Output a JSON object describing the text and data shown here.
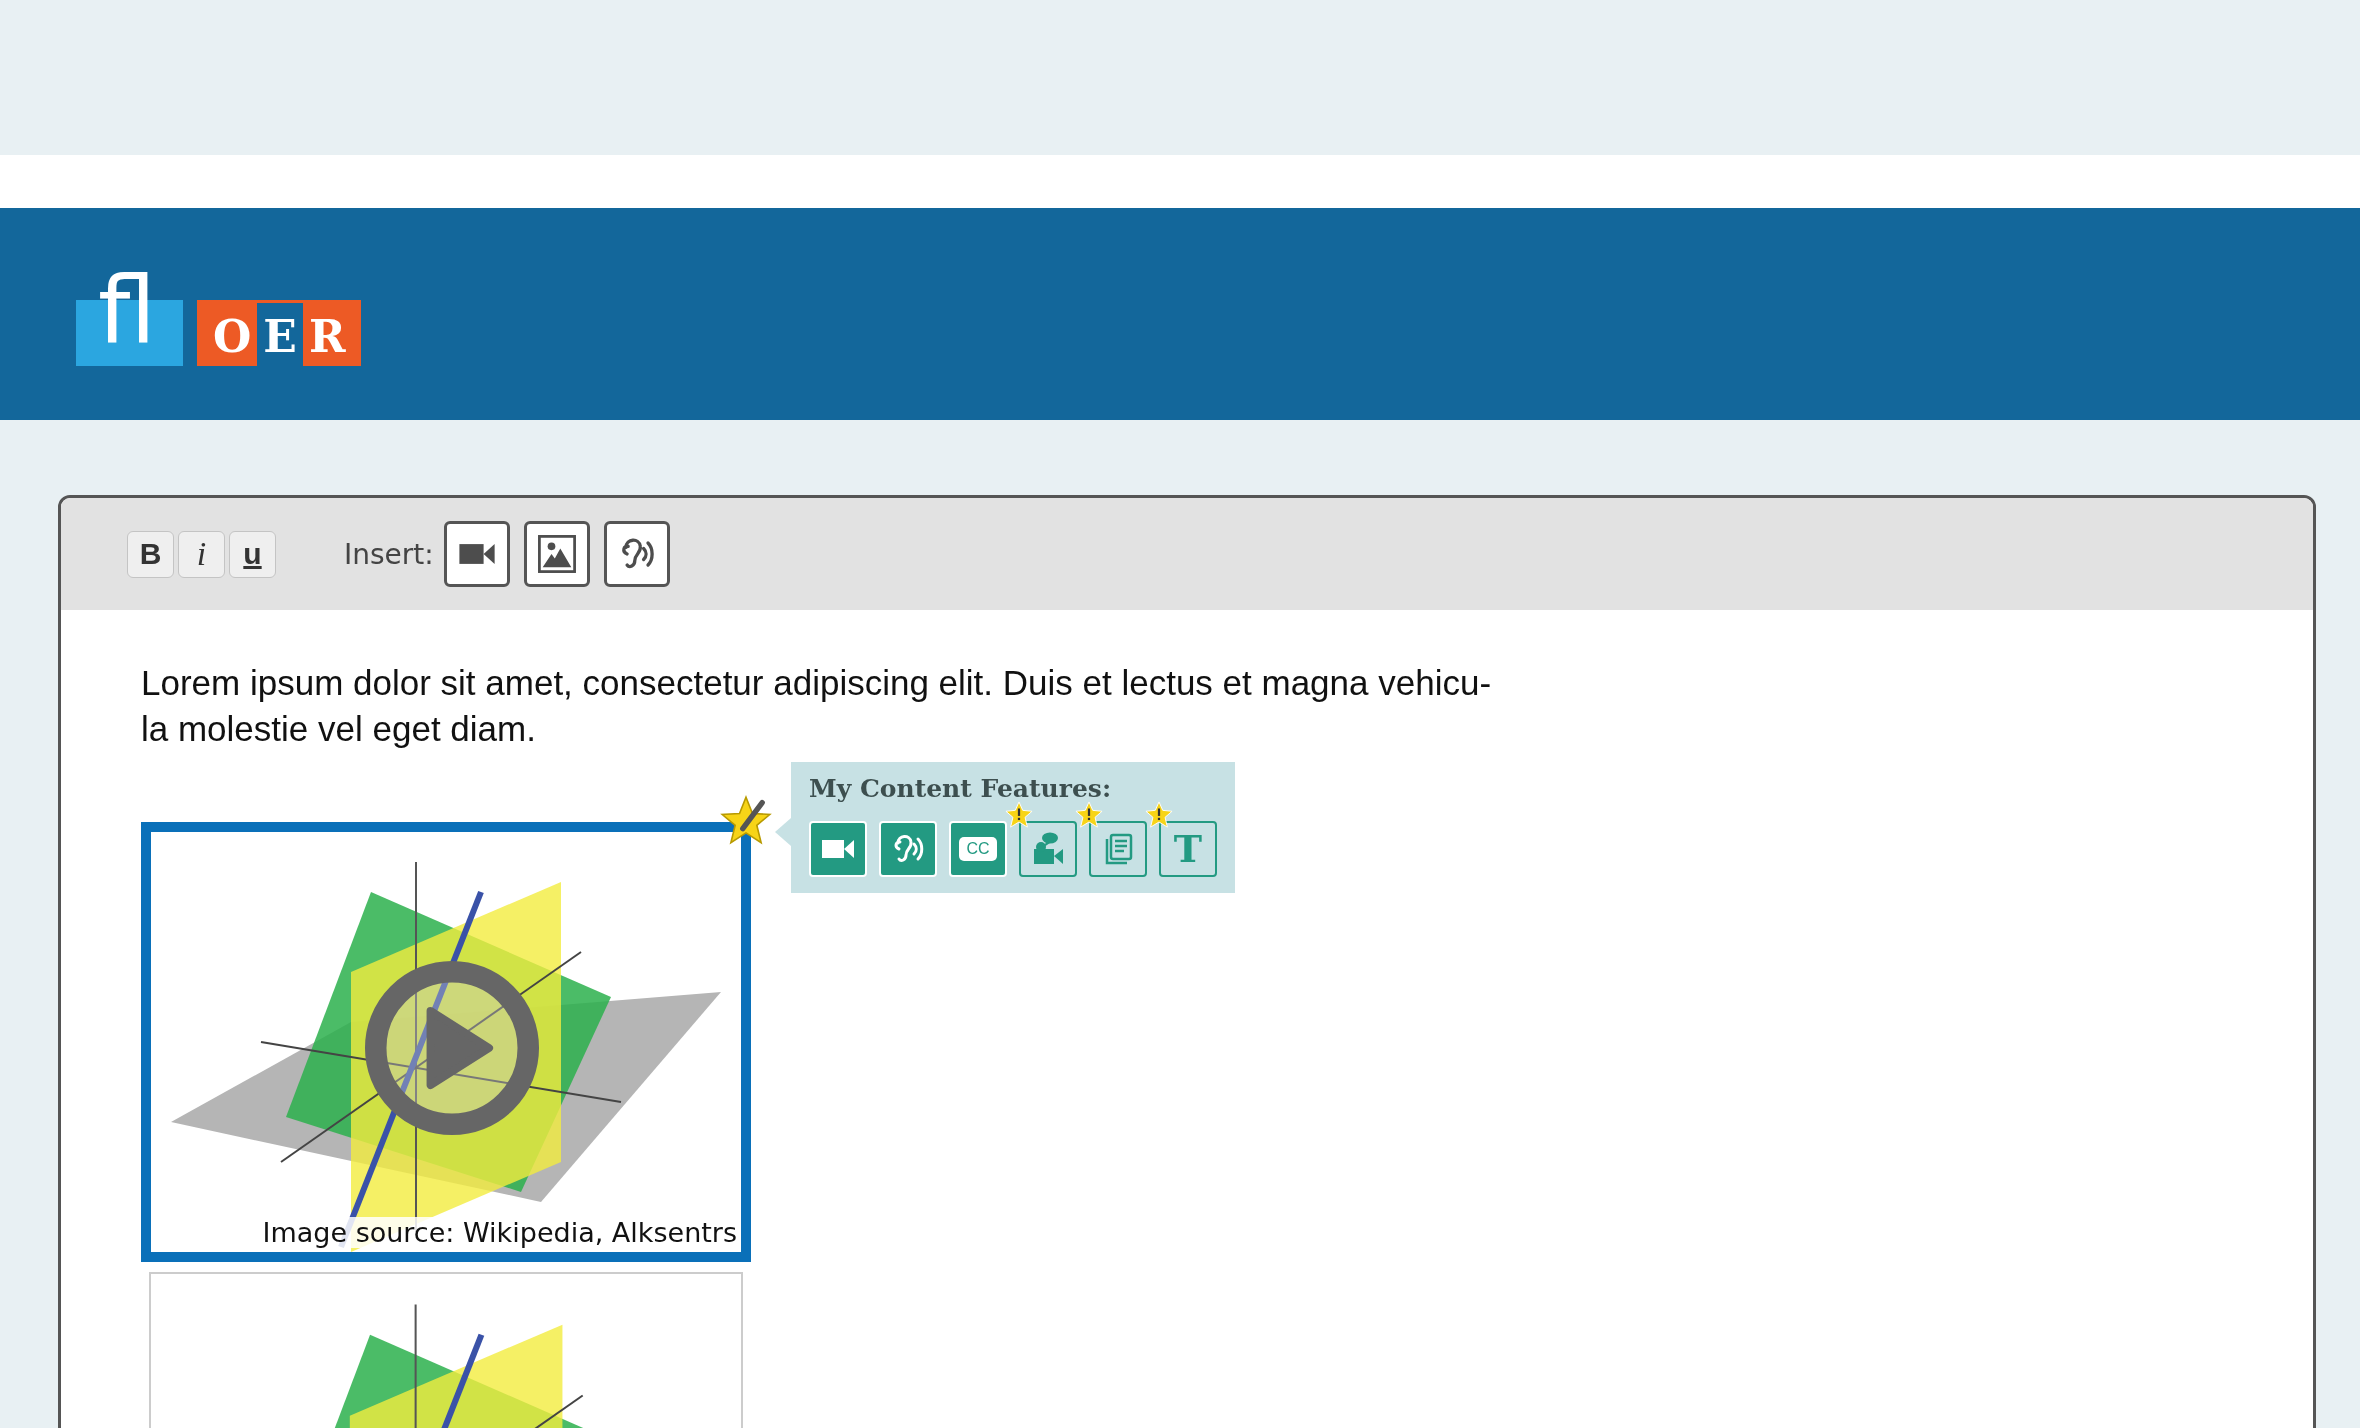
{
  "logo": {
    "mark": "fl",
    "letters": [
      {
        "text": "O",
        "highlight": false
      },
      {
        "text": "E",
        "highlight": true
      },
      {
        "text": "R",
        "highlight": false
      }
    ]
  },
  "toolbar": {
    "format_buttons": [
      {
        "label": "B",
        "kind": "bold"
      },
      {
        "label": "i",
        "kind": "italic"
      },
      {
        "label": "u",
        "kind": "underline"
      }
    ],
    "insert_label": "Insert:",
    "insert_buttons": [
      {
        "kind": "video"
      },
      {
        "kind": "image"
      },
      {
        "kind": "audio"
      }
    ]
  },
  "body": {
    "lines": [
      "Lorem ipsum dolor sit amet, consectetur adipiscing elit. Duis et lectus et magna vehicu-",
      "la molestie vel eget diam."
    ]
  },
  "media": [
    {
      "selected": true,
      "caption": "Image source: Wikipedia, Alksentrs",
      "starred": true
    },
    {
      "selected": false,
      "starred": false
    }
  ],
  "features": {
    "title": "My Content Features:",
    "items": [
      {
        "kind": "video",
        "active": true,
        "warning": false
      },
      {
        "kind": "audio",
        "active": true,
        "warning": false
      },
      {
        "kind": "captions",
        "label": "CC",
        "active": true,
        "warning": false
      },
      {
        "kind": "sign",
        "active": false,
        "warning": true
      },
      {
        "kind": "transcript",
        "active": false,
        "warning": true
      },
      {
        "kind": "text",
        "label": "T",
        "active": false,
        "warning": true
      }
    ]
  }
}
